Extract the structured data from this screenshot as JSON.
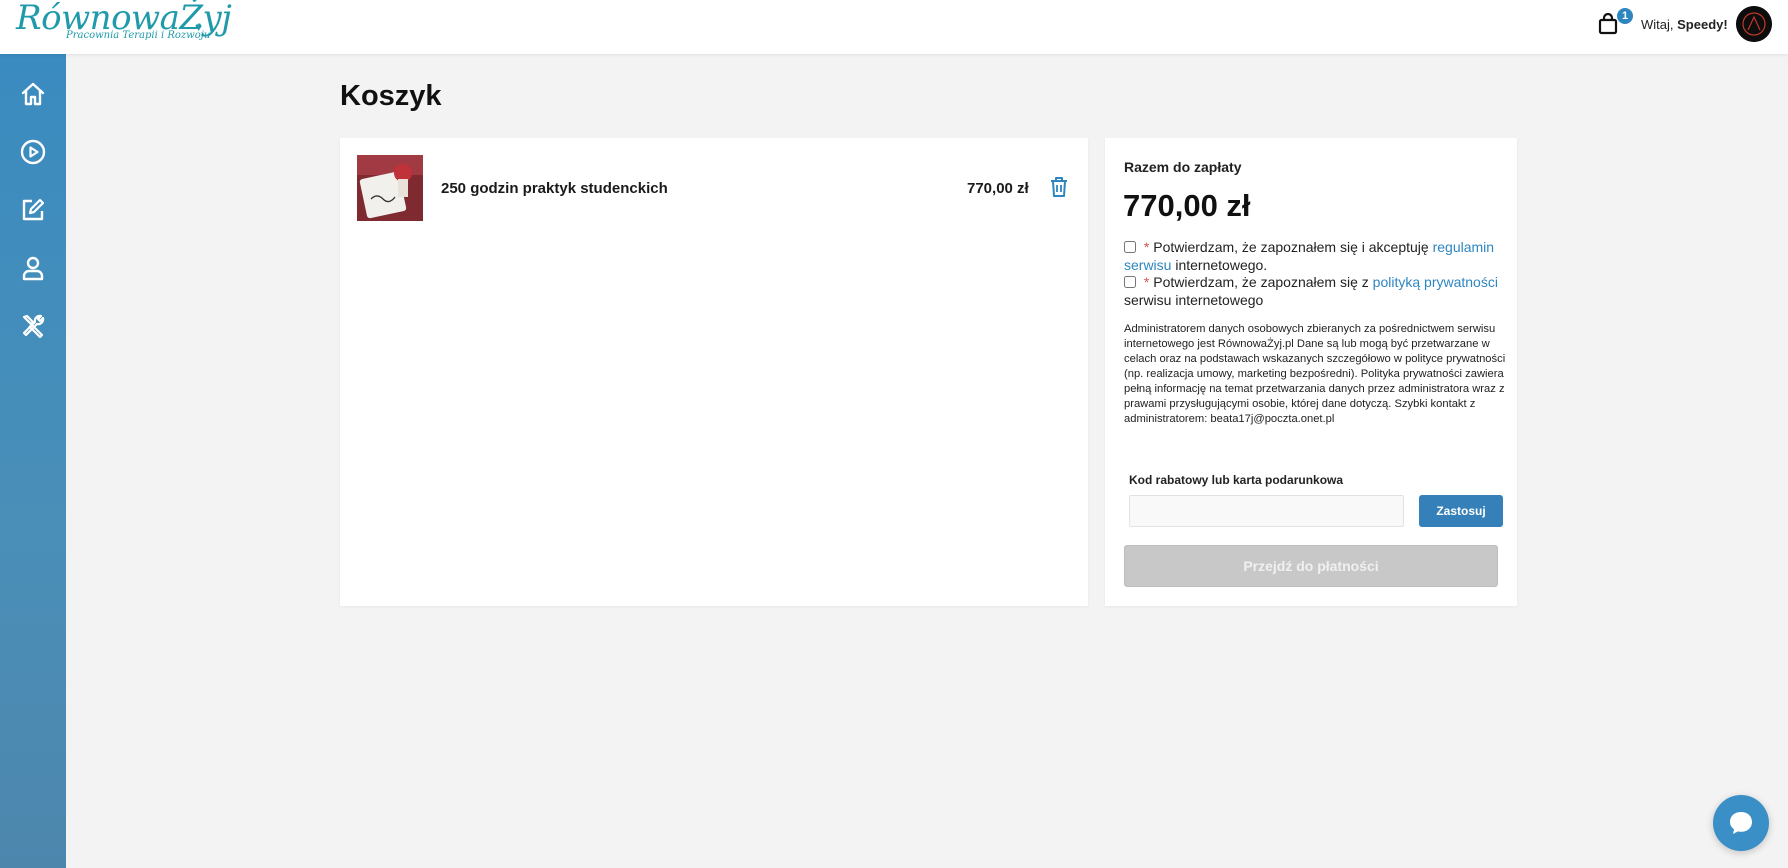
{
  "header": {
    "logo_text": "RównowaŻyj",
    "logo_subtitle": "Pracownia Terapii i Rozwoju",
    "cart_count": "1",
    "greeting_prefix": "Witaj, ",
    "user_name": "Speedy!"
  },
  "sidebar": {
    "items": [
      {
        "icon": "home-icon"
      },
      {
        "icon": "play-circle-icon"
      },
      {
        "icon": "edit-icon"
      },
      {
        "icon": "user-icon"
      },
      {
        "icon": "tools-icon"
      }
    ]
  },
  "page": {
    "title": "Koszyk"
  },
  "cart": {
    "items": [
      {
        "name": "250 godzin praktyk studenckich",
        "price": "770,00 zł"
      }
    ]
  },
  "summary": {
    "label": "Razem do zapłaty",
    "total": "770,00 zł",
    "required_mark": "*",
    "consent1_text": "Potwierdzam, że zapoznałem się i akceptuję",
    "consent1_link": "regulamin serwisu",
    "consent1_suffix": "internetowego.",
    "consent2_text": "Potwierdzam, że zapoznałem się z",
    "consent2_link": "polityką prywatności",
    "consent2_suffix": "serwisu internetowego",
    "legal_text": "Administratorem danych osobowych zbieranych za pośrednictwem serwisu internetowego jest RównowaŻyj.pl Dane są lub mogą być przetwarzane w celach oraz na podstawach wskazanych szczegółowo w polityce prywatności (np. realizacja umowy, marketing bezpośredni). Polityka prywatności zawiera pełną informację na temat przetwarzania danych przez administratora wraz z prawami przysługującymi osobie, której dane dotyczą. Szybki kontakt z administratorem: beata17j@poczta.onet.pl",
    "promo_label": "Kod rabatowy lub karta podarunkowa",
    "promo_value": "",
    "apply_label": "Zastosuj",
    "pay_label": "Przejdź do płatności"
  },
  "colors": {
    "accent": "#3580b8",
    "sidebar": "#3a8bc0",
    "required": "#d9534f",
    "link": "#2e86c1"
  }
}
